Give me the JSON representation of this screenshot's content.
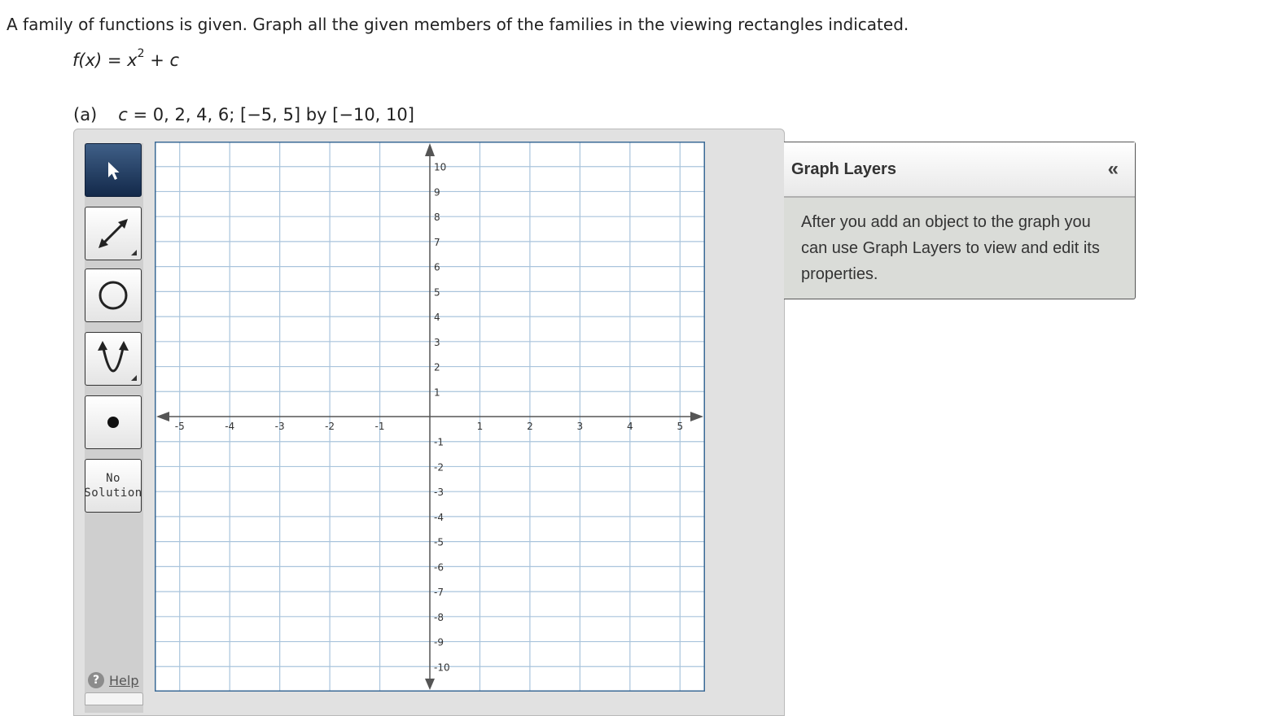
{
  "question": {
    "prompt": "A family of functions is given. Graph all the given members of the families in the viewing rectangles indicated.",
    "function": {
      "lhs": "f(x)",
      "eq": " = ",
      "base": "x",
      "exponent": "2",
      "rest": " + ",
      "const": "c"
    },
    "part_a": {
      "label": "(a)",
      "c_var": "c",
      "spec": " = 0, 2, 4, 6; [−5, 5] by [−10, 10]"
    }
  },
  "toolbar": {
    "tools": [
      {
        "name": "select-tool",
        "icon": "arrow-pointer-icon",
        "active": true
      },
      {
        "name": "line-tool",
        "icon": "double-arrow-line-icon",
        "active": false
      },
      {
        "name": "circle-tool",
        "icon": "circle-icon",
        "active": false
      },
      {
        "name": "parabola-tool",
        "icon": "parabola-icon",
        "active": false
      },
      {
        "name": "point-tool",
        "icon": "point-icon",
        "active": false
      }
    ],
    "no_solution_line1": "No",
    "no_solution_line2": "Solution",
    "help_label": "Help",
    "help_glyph": "?"
  },
  "graph": {
    "x_range": [
      -5.5,
      5.5
    ],
    "y_range": [
      -11,
      11
    ],
    "x_ticks": [
      "-5",
      "-4",
      "-3",
      "-2",
      "-1",
      "1",
      "2",
      "3",
      "4",
      "5"
    ],
    "y_ticks": [
      "10",
      "9",
      "8",
      "7",
      "6",
      "5",
      "4",
      "3",
      "2",
      "1",
      "-1",
      "-2",
      "-3",
      "-4",
      "-5",
      "-6",
      "-7",
      "-8",
      "-9",
      "-10"
    ],
    "grid_color": "#a9c4dc",
    "border_color": "#3b6a96"
  },
  "layers_panel": {
    "title": "Graph Layers",
    "collapse_glyph": "«",
    "body": "After you add an object to the graph you can use Graph Layers to view and edit its properties."
  }
}
